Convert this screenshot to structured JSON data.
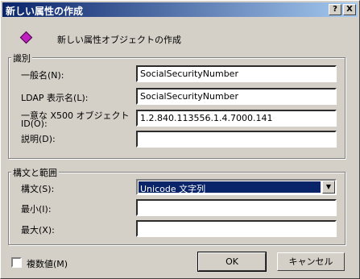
{
  "window": {
    "title": "新しい属性の作成",
    "help_glyph": "?",
    "close_glyph": "X"
  },
  "header": {
    "icon": "attribute-icon",
    "text": "新しい属性オブジェクトの作成"
  },
  "identification": {
    "legend": "識別",
    "common_name_label": "一般名(N):",
    "common_name_value": "SocialSecurityNumber",
    "ldap_label": "LDAP 表示名(L):",
    "ldap_value": "SocialSecurityNumber",
    "oid_label_line1": "一意な X500 オブジェクト",
    "oid_label_line2": "ID(O):",
    "oid_value": "1.2.840.113556.1.4.7000.141",
    "description_label": "説明(D):",
    "description_value": ""
  },
  "syntax_range": {
    "legend": "構文と範囲",
    "syntax_label": "構文(S):",
    "syntax_value": "Unicode 文字列",
    "min_label": "最小(I):",
    "min_value": "",
    "max_label": "最大(X):",
    "max_value": ""
  },
  "multivalue": {
    "label": "複数値(M)",
    "checked": false
  },
  "buttons": {
    "ok": "OK",
    "cancel": "キャンセル"
  }
}
